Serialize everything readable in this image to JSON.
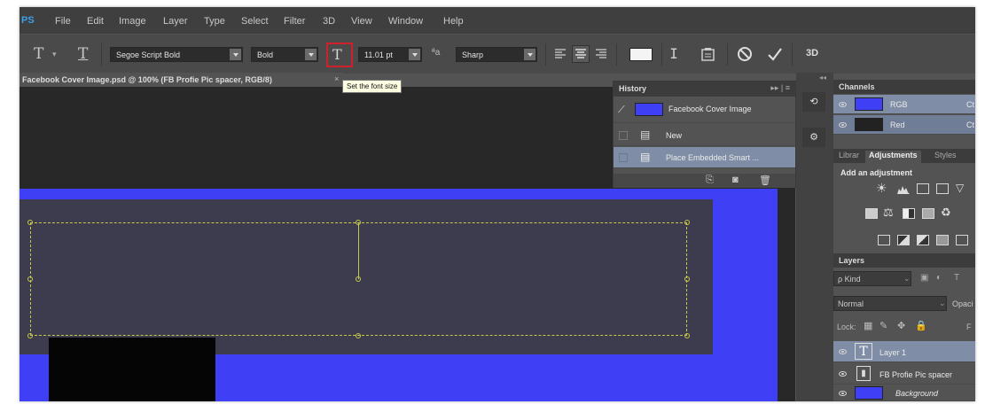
{
  "app": {
    "logo": "PS"
  },
  "menu": [
    "File",
    "Edit",
    "Image",
    "Layer",
    "Type",
    "Select",
    "Filter",
    "3D",
    "View",
    "Window",
    "Help"
  ],
  "options": {
    "font_family": "Segoe Script Bold",
    "font_style": "Bold",
    "font_size": "11.01 pt",
    "aa_label": "ªa",
    "antialias": "Sharp",
    "label_3d": "3D",
    "tooltip": "Set the font size"
  },
  "document": {
    "tab_title": "Facebook Cover Image.psd @ 100% (FB Profie Pic spacer, RGB/8)",
    "close": "×"
  },
  "history": {
    "title": "History",
    "menu": "▸▸ | ≡",
    "snapshot": "Facebook Cover Image",
    "items": [
      "New",
      "Place Embedded Smart ..."
    ]
  },
  "channels": {
    "title": "Channels",
    "rows": [
      {
        "name": "RGB",
        "shortcut": "Ct"
      },
      {
        "name": "Red",
        "shortcut": "Ct"
      }
    ]
  },
  "adjustments": {
    "tabs": [
      "Librar",
      "Adjustments",
      "Styles"
    ],
    "heading": "Add an adjustment"
  },
  "layers": {
    "title": "Layers",
    "kind": "ρ Kind",
    "mode": "Normal",
    "opacity_label": "Opaci",
    "lock_label": "Lock:",
    "fill_label": "F",
    "items": [
      {
        "name": "Layer 1",
        "type": "text"
      },
      {
        "name": "FB Profie Pic spacer",
        "type": "smart"
      },
      {
        "name": "Background",
        "type": "fill"
      }
    ]
  },
  "colors": {
    "accent_blue": "#3f3ff5",
    "highlight_red": "#d0202b",
    "selection": "#c8c84a"
  }
}
